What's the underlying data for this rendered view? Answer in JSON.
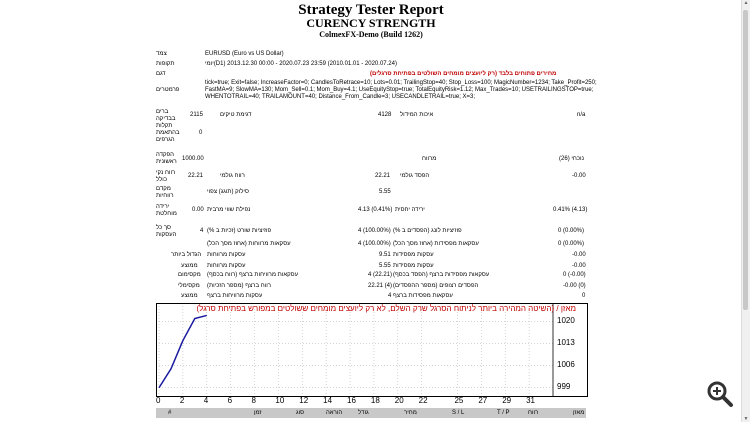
{
  "report": {
    "title": "Strategy Tester Report",
    "subtitle": "CURENCY STRENGTH",
    "server": "ColmexFX-Demo (Build 1262)"
  },
  "fields": {
    "symbol_label": "צמד",
    "symbol_value": "EURUSD (Euro vs US Dollar)",
    "period_label": "תקופות",
    "period_value": "יומי(D1) 2013.12.30 00:00 - 2020.07.23 23:59 (2010.01.01 - 2020.07.24)",
    "model_label": "דגם",
    "model_value": "מחירים פתוחים בלבד (רק ליועצים מומחים השולטים בפתיחת סרגלים)",
    "params_label": "פרמטרים",
    "params_line1": "tick=true; Exit=false; IncreaseFactor=0; CandlesToRetrace=10; Lots=0.01; TrailingStop=40; Stop_Loss=100; MagicNumber=1234; Take_Profit=250;",
    "params_line2": "FastMA=9; SlowMA=130; Mom_Sell=0.1; Mom_Buy=4.1; UseEquityStop=true; TotalEquityRisk=1.12; Max_Trades=10; USETRAILINGSTOP=true;",
    "params_line3": "WHENTOTRAIL=40; TRAILAMOUNT=40; Distance_From_Candle=3; USECANDLETRAIL=true; X=3;"
  },
  "stats": {
    "bars_label": "ברים",
    "bars_label2": "בבדיקה",
    "bars_value": "2115",
    "ticks_label": "דגימת טיקים",
    "ticks_value": "4128",
    "quality_label": "איכות המידול",
    "quality_value": "n/a",
    "errors_label1": "תקלות",
    "errors_label2": "בהתאמת",
    "errors_label3": "הגרפים",
    "errors_value": "0",
    "deposit_label1": "הפקדה",
    "deposit_label2": "ראשונית",
    "deposit_value": "1000.00",
    "spread_label": "מרווח",
    "spread_value": "נוכחי (26)",
    "netprofit_label1": "רווח נקי",
    "netprofit_label2": "כולל",
    "netprofit_value": "22.21",
    "grossprofit_label": "רווח גולמי",
    "grossprofit_value": "22.21",
    "grossloss_label": "הפסד גולמי",
    "grossloss_value": "-0.00",
    "pf_label1": "מקדם",
    "pf_label2": "רווחיות",
    "pf_value": "",
    "payoff_label": "סילוק (תוגג) צפוי",
    "payoff_value": "5.55",
    "dd_label1": "ירידה",
    "dd_label2": "מוחלטת",
    "dd_value": "0.00",
    "maxdd_label": "נפילת שווי מרבית",
    "maxdd_value": "4.13 (0.41%)",
    "reldd_label": "ירידה יחסית",
    "reldd_value": "0.41% (4.13)",
    "trades_label1": "סך כל",
    "trades_label2": "העסקות",
    "trades_value": "4",
    "short_label": "פוזיציות שורט (זכיות ב %)",
    "short_value": "4 (100.00%)",
    "long_label": "פוזיציות לונג (הפסדים ב %)",
    "long_value": "0 (0.00%)",
    "profit_trades_label": "עסקאות מרווחות (אחוז מסך הכל)",
    "profit_trades_value": "4 (100.00%)",
    "loss_trades_label": "עסקאות מפסידות (אחוז מסך הכל)",
    "loss_trades_value": "0 (0.00%)",
    "largest_label": "הגדול ביותר",
    "largest_profit_label": "עסקות מרווחות",
    "largest_profit_value": "9.51",
    "largest_loss_label": "עסקות מפסידות",
    "largest_loss_value": "-0.00",
    "avg_label": "ממוצע",
    "avg_profit_label": "עסקות מרווחות",
    "avg_profit_value": "5.55",
    "avg_loss_label": "עסקות מפסידות",
    "avg_loss_value": "-0.00",
    "max_label": "מקסימום",
    "max_cons_wins_label": "עסקאות מרוויחות ברצף (רווח בכסף)",
    "max_cons_wins_value": "4 (22.21)",
    "max_cons_losses_label": "עסקאות מפסידות ברצף (הפסד בכסף)",
    "max_cons_losses_value": "0 (-0.00)",
    "maximal_label": "מקסימלי",
    "max_cons_profit_label": "רווח ברצף (מספר הזכיות)",
    "max_cons_profit_value": "22.21 (4)",
    "max_cons_loss_label": "הפסדים רצופים (מספר ההפסדים)",
    "max_cons_loss_value": "-0.00 (0)",
    "average_label": "ממוצע",
    "avg_cons_wins_label": "עסקות מרוויחות ברצף",
    "avg_cons_wins_value": "4",
    "avg_cons_losses_label": "עסקאות מפסידות ברצף",
    "avg_cons_losses_value": "0"
  },
  "chart_data": {
    "type": "line",
    "title": "(השיטה המהירה ביותר לניתוח הסרגל שרק השלם, לא רק ליועצים מומחים ששולטים במפורש בפתיחת סרגל) / מאזן",
    "x": [
      0,
      1,
      2,
      3,
      4
    ],
    "series": [
      {
        "values": [
          999,
          1005,
          1014,
          1021,
          1022
        ]
      }
    ],
    "xticks": [
      "0",
      "2",
      "4",
      "6",
      "8",
      "10",
      "12",
      "14",
      "16",
      "18",
      "20",
      "22",
      "25",
      "27",
      "29",
      "31"
    ],
    "yticks": [
      "1020",
      "1013",
      "1006",
      "999"
    ],
    "xlim": [
      0,
      33
    ],
    "ylim": [
      997,
      1025
    ],
    "line_color": "#1a1aa0"
  },
  "table_header": {
    "col_hash": "#",
    "col_time": "זמן",
    "col_type": "סוג",
    "col_order": "הוראה",
    "col_size": "גודל",
    "col_price": "מחיר",
    "col_sl": "S / L",
    "col_tp": "T / P",
    "col_profit": "רווח",
    "col_balance": "מאזן"
  },
  "ui": {
    "zoom_icon": "zoom-in-icon"
  }
}
